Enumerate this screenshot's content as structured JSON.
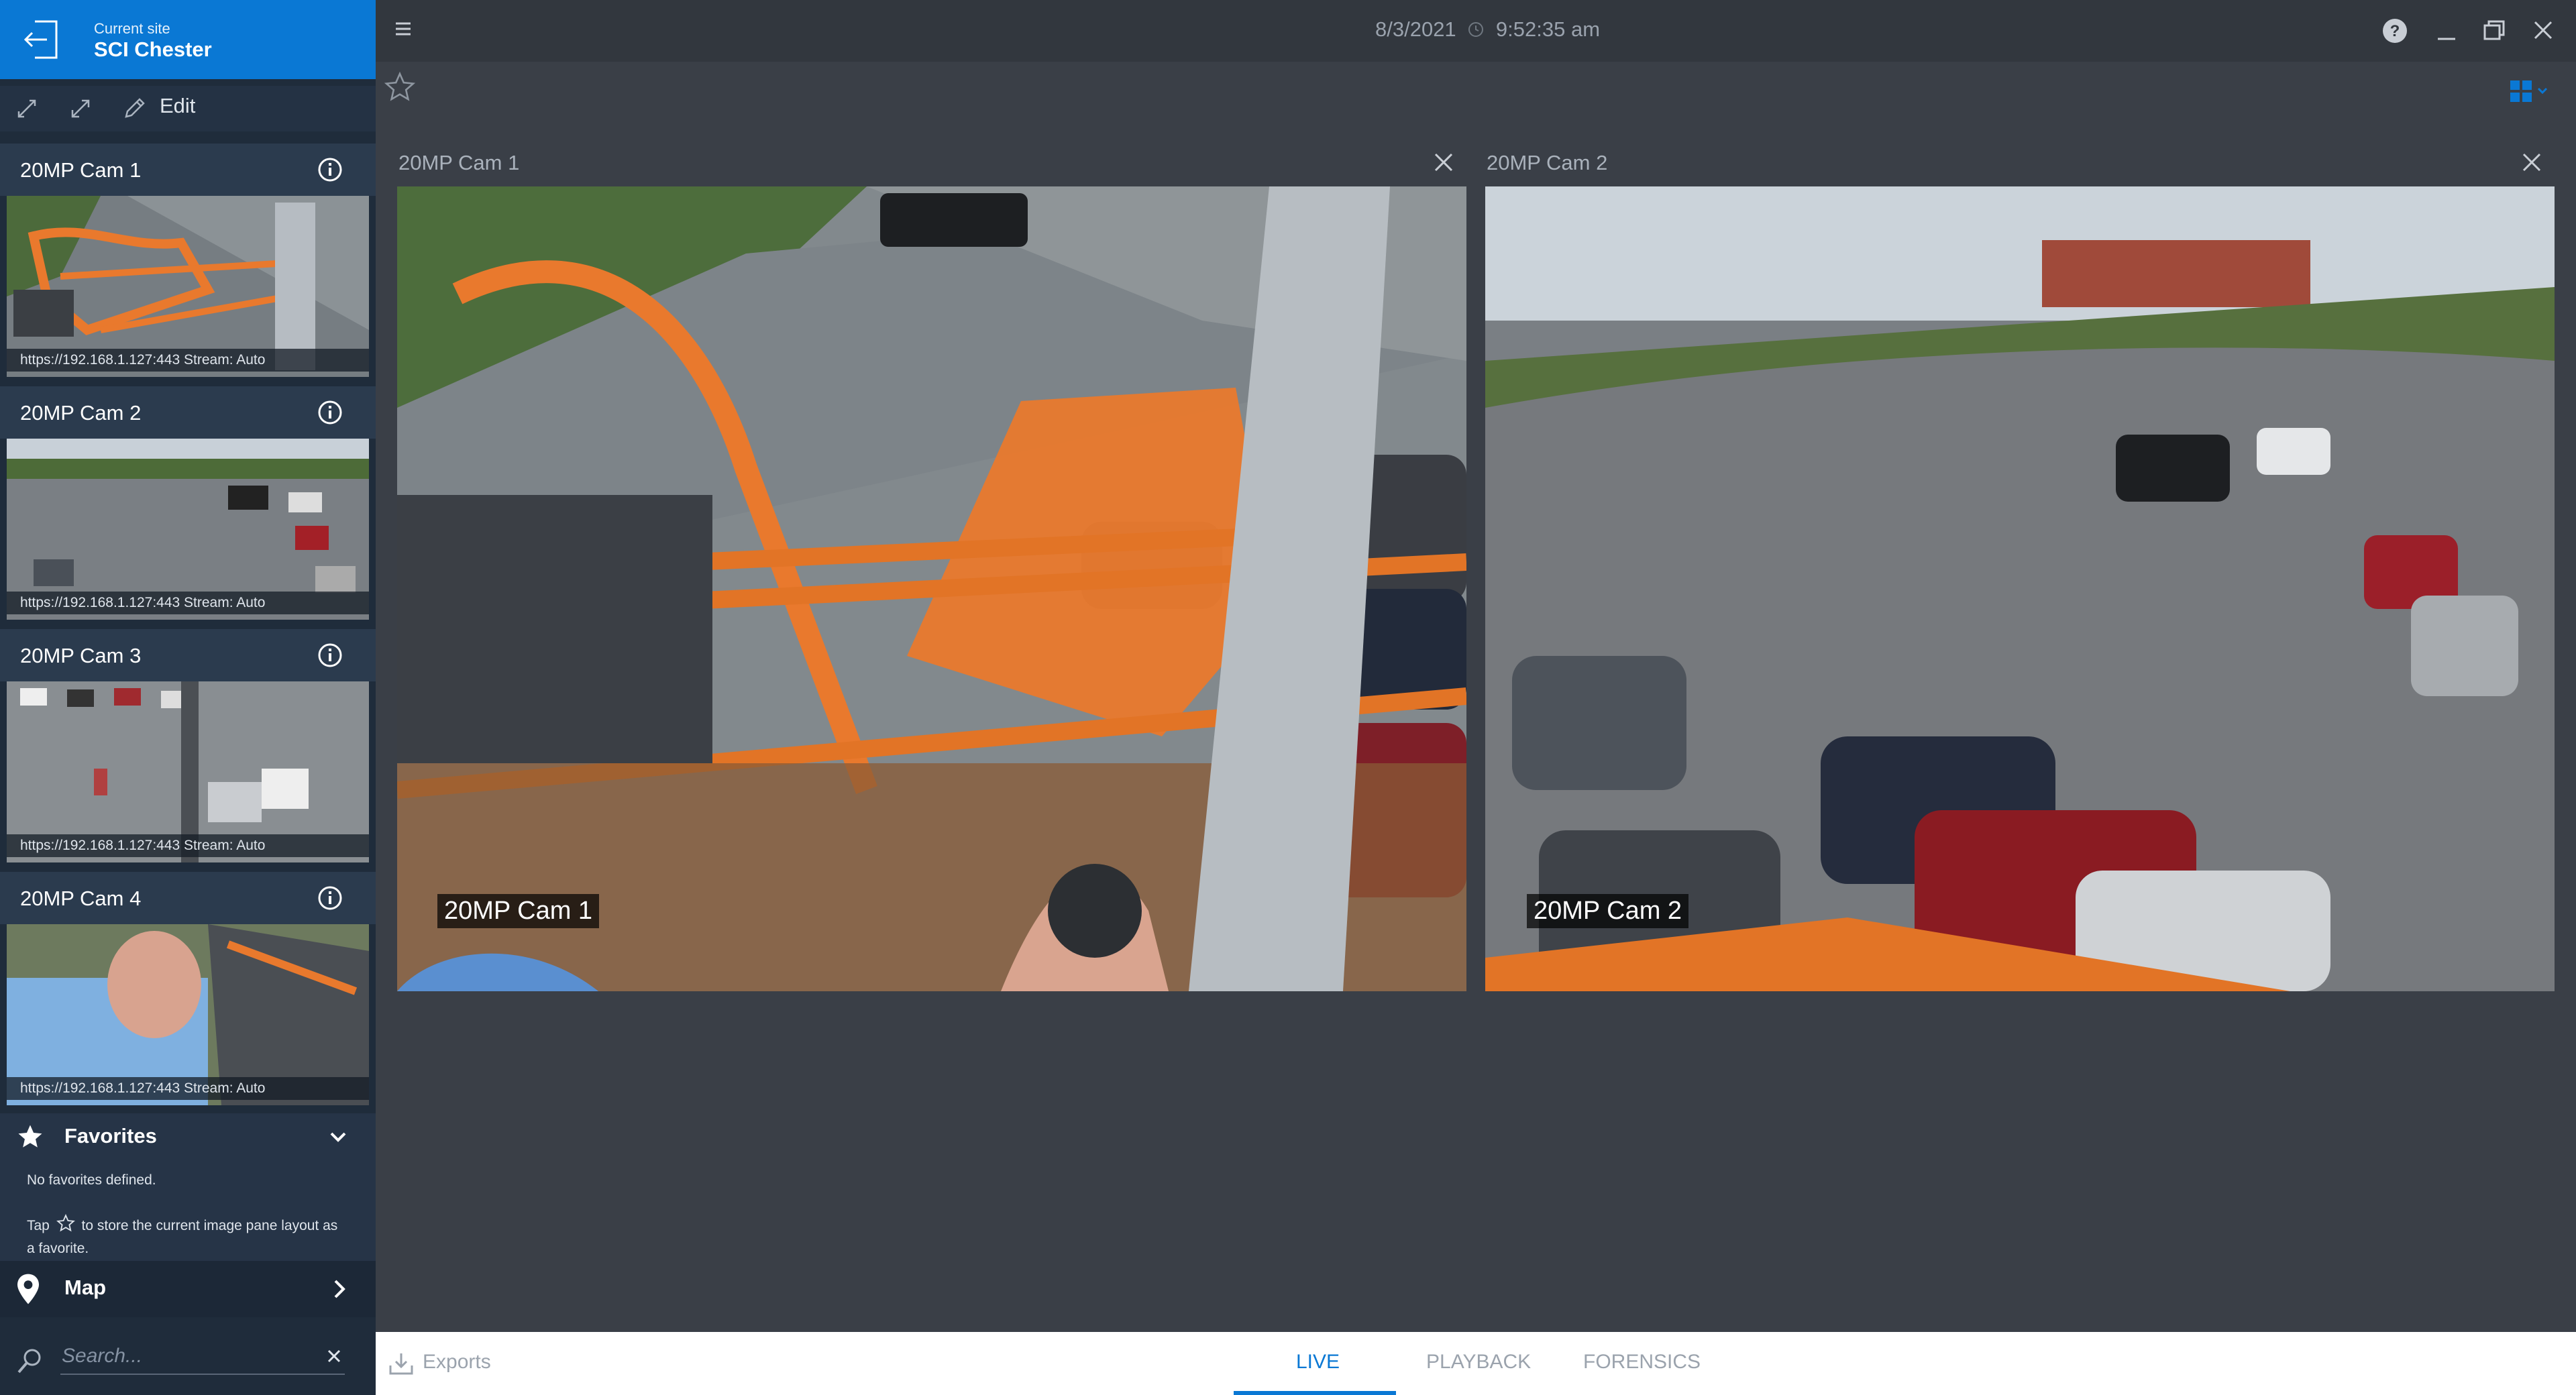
{
  "sidebar": {
    "site_label": "Current site",
    "site_name": "SCI Chester",
    "edit_label": "Edit",
    "cameras": [
      {
        "title": "20MP Cam 1",
        "url": "https://192.168.1.127:443 Stream: Auto"
      },
      {
        "title": "20MP Cam 2",
        "url": "https://192.168.1.127:443 Stream: Auto"
      },
      {
        "title": "20MP Cam 3",
        "url": "https://192.168.1.127:443 Stream: Auto"
      },
      {
        "title": "20MP Cam 4",
        "url": "https://192.168.1.127:443 Stream: Auto"
      }
    ],
    "favorites": {
      "title": "Favorites",
      "empty": "No favorites defined.",
      "hint_pre": "Tap",
      "hint_post": "to store the current image pane layout as a favorite."
    },
    "map_label": "Map",
    "search": {
      "placeholder": "Search..."
    }
  },
  "topbar": {
    "date": "8/3/2021",
    "time": "9:52:35 am"
  },
  "panes": [
    {
      "title": "20MP Cam 1",
      "overlay": "20MP Cam 1"
    },
    {
      "title": "20MP Cam 2",
      "overlay": "20MP Cam 2"
    }
  ],
  "bottom": {
    "exports": "Exports",
    "tabs": [
      {
        "label": "LIVE",
        "active": true
      },
      {
        "label": "PLAYBACK",
        "active": false
      },
      {
        "label": "FORENSICS",
        "active": false
      }
    ]
  },
  "colors": {
    "accent": "#0a78d4",
    "sidebar": "#1f2c3b",
    "workspace": "#3a3f47"
  }
}
